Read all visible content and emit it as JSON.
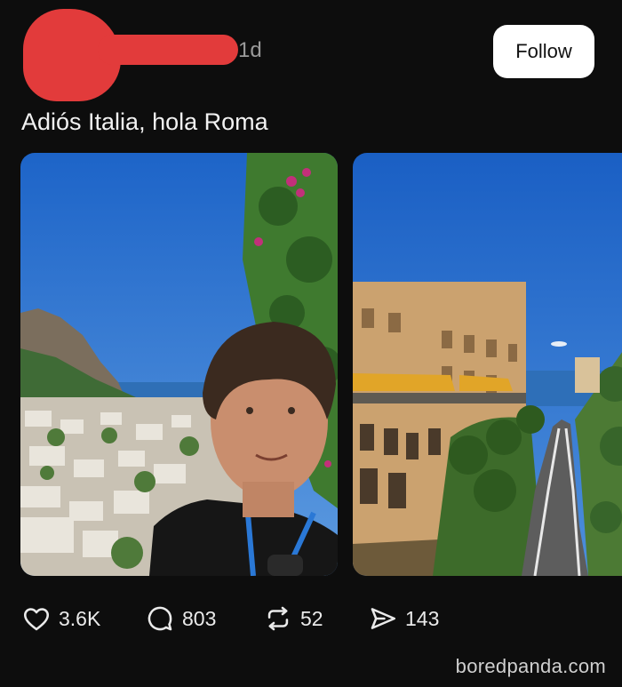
{
  "post": {
    "timestamp": "1d",
    "follow_label": "Follow",
    "caption": "Adiós Italia, hola Roma"
  },
  "actions": {
    "likes": "3.6K",
    "replies": "803",
    "reposts": "52",
    "shares": "143"
  },
  "icons": {
    "like": "heart-icon",
    "reply": "speech-bubble-icon",
    "repost": "repost-arrows-icon",
    "share": "paper-plane-icon"
  },
  "watermark": "boredpanda.com",
  "colors": {
    "background": "#0d0d0d",
    "redaction": "#e23b3b",
    "follow_button": "#ffffff"
  }
}
